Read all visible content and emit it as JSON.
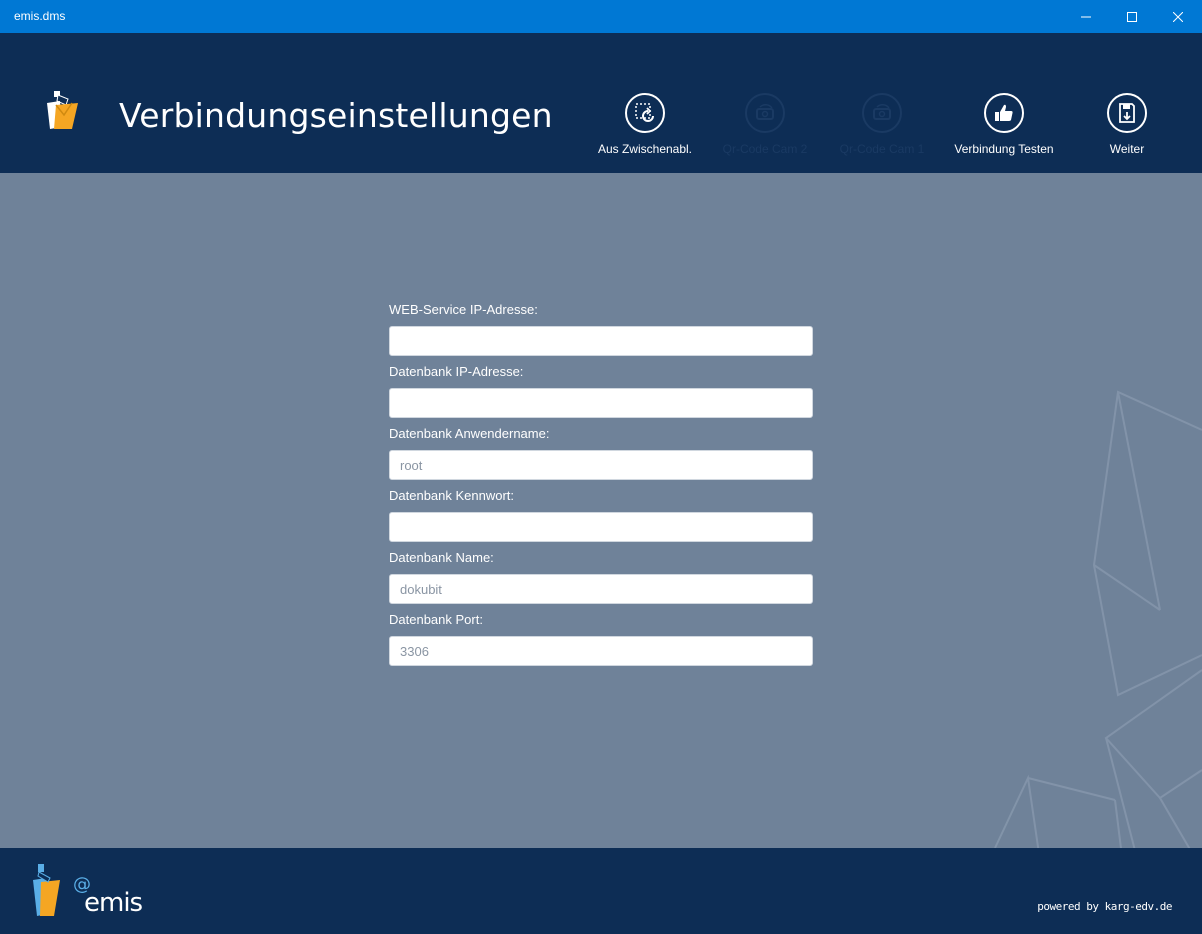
{
  "window": {
    "title": "emis.dms"
  },
  "header": {
    "page_title": "Verbindungseinstellungen",
    "toolbar": [
      {
        "label": "Aus Zwischenabl.",
        "icon": "clipboard-refresh-icon",
        "enabled": true
      },
      {
        "label": "Qr-Code Cam 2",
        "icon": "camera-rotate-icon",
        "enabled": false
      },
      {
        "label": "Qr-Code Cam 1",
        "icon": "camera-rotate-icon",
        "enabled": false
      },
      {
        "label": "Verbindung Testen",
        "icon": "thumbs-up-icon",
        "enabled": true
      },
      {
        "label": "Weiter",
        "icon": "save-download-icon",
        "enabled": true
      }
    ]
  },
  "form": {
    "webservice_ip": {
      "label": "WEB-Service IP-Adresse:",
      "value": "",
      "placeholder": ""
    },
    "db_ip": {
      "label": "Datenbank IP-Adresse:",
      "value": "",
      "placeholder": ""
    },
    "db_user": {
      "label": "Datenbank Anwendername:",
      "value": "",
      "placeholder": "root"
    },
    "db_password": {
      "label": "Datenbank Kennwort:",
      "value": "",
      "placeholder": ""
    },
    "db_name": {
      "label": "Datenbank Name:",
      "value": "",
      "placeholder": "dokubit"
    },
    "db_port": {
      "label": "Datenbank Port:",
      "value": "",
      "placeholder": "3306"
    }
  },
  "footer": {
    "brand_at": "@",
    "brand_name": "emis",
    "powered_by": "powered by karg-edv.de"
  },
  "colors": {
    "titlebar": "#0078d4",
    "header": "#0d2d55",
    "body": "#6f8299",
    "accent_orange": "#f5a623",
    "accent_blue": "#5aaee6"
  }
}
